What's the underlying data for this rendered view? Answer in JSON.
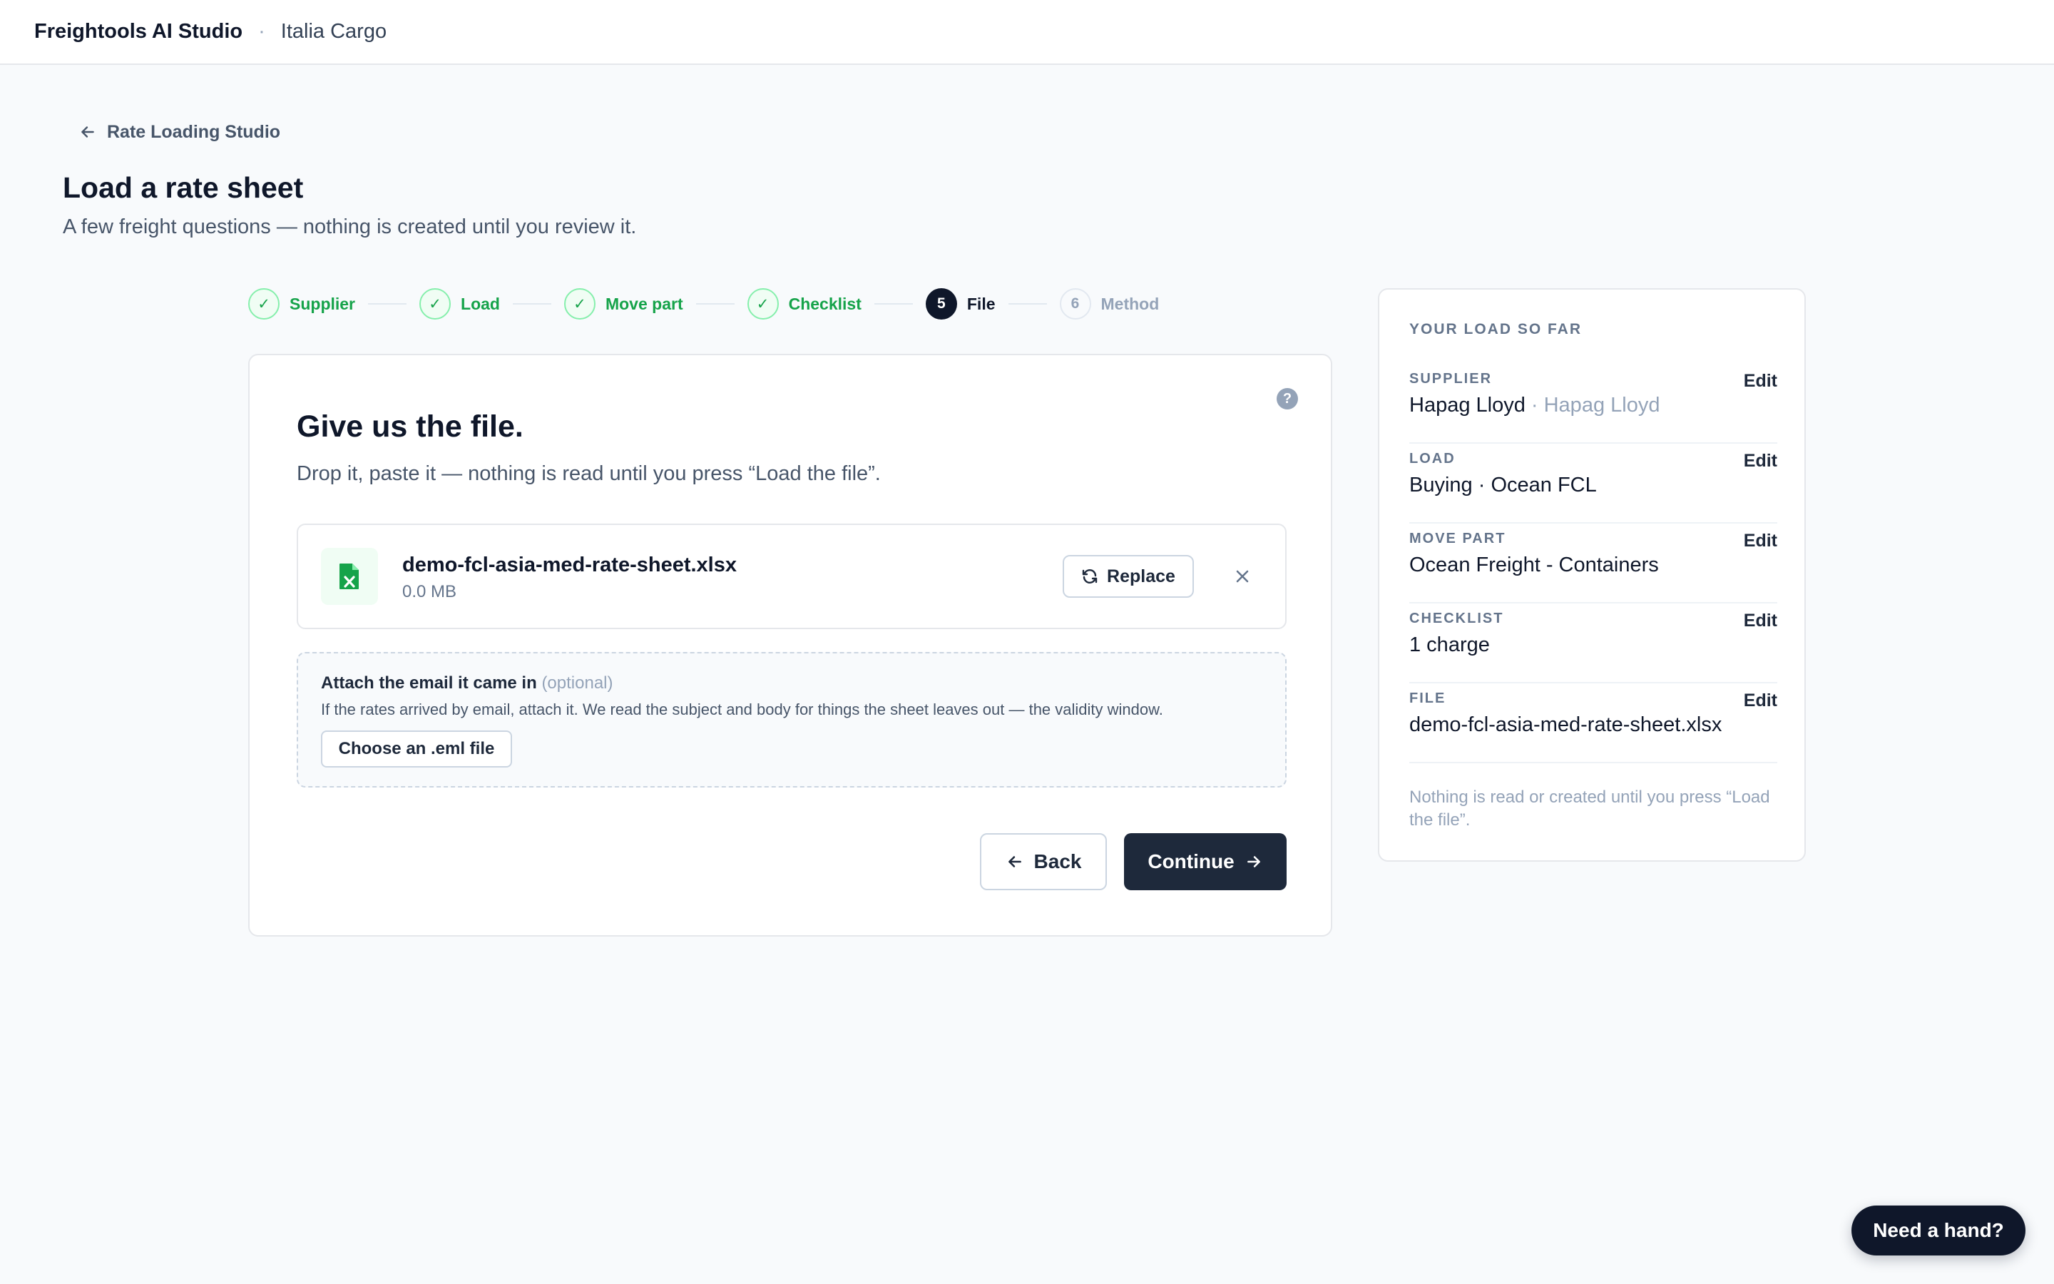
{
  "topbar": {
    "brand": "Freightools AI Studio",
    "separator": "·",
    "org": "Italia Cargo"
  },
  "back_link": {
    "label": "Rate Loading Studio",
    "icon": "arrow-left-icon"
  },
  "page": {
    "title": "Load a rate sheet",
    "subtitle": "A few freight questions — nothing is created until you review it."
  },
  "stepper": {
    "steps": [
      {
        "marker": "✓",
        "label": "Supplier",
        "state": "done"
      },
      {
        "marker": "✓",
        "label": "Load",
        "state": "done"
      },
      {
        "marker": "✓",
        "label": "Move part",
        "state": "done"
      },
      {
        "marker": "✓",
        "label": "Checklist",
        "state": "done"
      },
      {
        "marker": "5",
        "label": "File",
        "state": "active"
      },
      {
        "marker": "6",
        "label": "Method",
        "state": "todo"
      }
    ]
  },
  "card": {
    "help": "?",
    "title": "Give us the file.",
    "subtitle": "Drop it, paste it — nothing is read until you press “Load the file”.",
    "file": {
      "icon": "excel-file-icon",
      "name": "demo-fcl-asia-med-rate-sheet.xlsx",
      "size": "0.0 MB",
      "replace_label": "Replace"
    },
    "email": {
      "title": "Attach the email it came in",
      "optional": "(optional)",
      "description": "If the rates arrived by email, attach it. We read the subject and body for things the sheet leaves out — the validity window.",
      "button_label": "Choose an .eml file"
    },
    "back_label": "Back",
    "continue_label": "Continue"
  },
  "summary": {
    "heading": "YOUR LOAD SO FAR",
    "rows": [
      {
        "label": "SUPPLIER",
        "value": "Hapag Lloyd",
        "muted": " · Hapag Lloyd",
        "edit": "Edit"
      },
      {
        "label": "LOAD",
        "value": "Buying · Ocean FCL",
        "edit": "Edit"
      },
      {
        "label": "MOVE PART",
        "value": "Ocean Freight - Containers",
        "edit": "Edit"
      },
      {
        "label": "CHECKLIST",
        "value": "1 charge",
        "edit": "Edit"
      },
      {
        "label": "FILE",
        "value": "demo-fcl-asia-med-rate-sheet.xlsx",
        "edit": "Edit"
      }
    ],
    "note": "Nothing is read or created until you press “Load the file”."
  },
  "help_button": {
    "label": "Need a hand?"
  },
  "colors": {
    "primary": "#1e293b",
    "success": "#16a34a",
    "background": "#f8fafc"
  }
}
